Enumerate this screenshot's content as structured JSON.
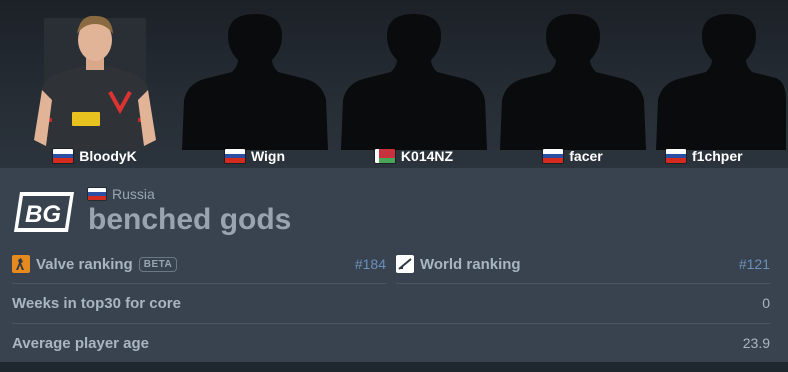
{
  "players": [
    {
      "name": "BloodyK",
      "flag": "russia-flag",
      "has_photo": true
    },
    {
      "name": "Wign",
      "flag": "russia-flag",
      "has_photo": false
    },
    {
      "name": "K014NZ",
      "flag": "belarus-flag",
      "has_photo": false
    },
    {
      "name": "facer",
      "flag": "russia-flag",
      "has_photo": false
    },
    {
      "name": "f1chper",
      "flag": "russia-flag",
      "has_photo": false
    }
  ],
  "team": {
    "logo_text": "BG",
    "country": "Russia",
    "country_flag": "russia-flag",
    "name": "benched gods"
  },
  "rankings": {
    "valve": {
      "label": "Valve ranking",
      "badge": "BETA",
      "value": "#184",
      "icon": "valve-ranking-icon"
    },
    "world": {
      "label": "World ranking",
      "value": "#121",
      "icon": "world-ranking-icon"
    }
  },
  "stats": {
    "weeks_label": "Weeks in top30 for core",
    "weeks_value": "0",
    "age_label": "Average player age",
    "age_value": "23.9"
  },
  "colors": {
    "ranking_value": "#6b8fb8",
    "stat_value": "#a9b5c0",
    "valve_icon_bg": "#e58a1f"
  }
}
